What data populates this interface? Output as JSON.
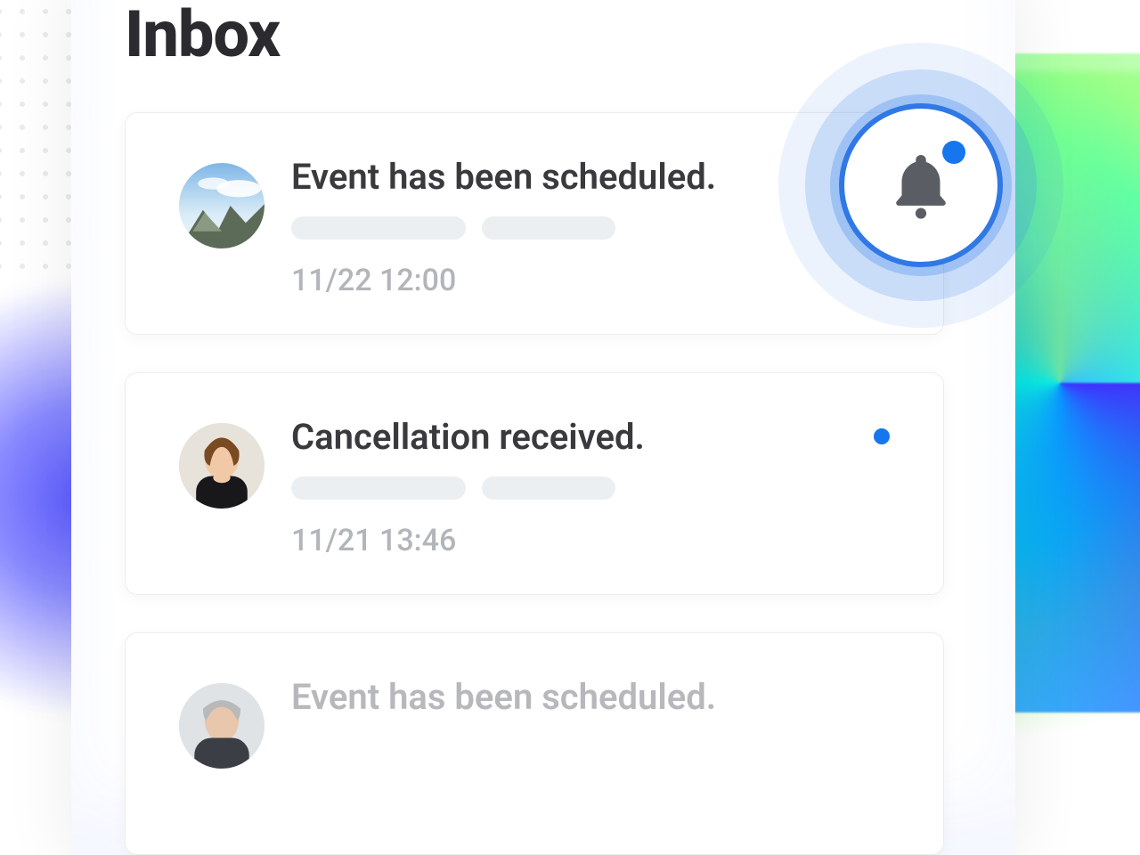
{
  "title": "Inbox",
  "bell": {
    "unread": true
  },
  "cards": [
    {
      "subject": "Event has been scheduled.",
      "timestamp": "11/22 12:00",
      "unread": true,
      "avatar": "mountain"
    },
    {
      "subject": "Cancellation received.",
      "timestamp": "11/21 13:46",
      "unread": true,
      "avatar": "person1"
    },
    {
      "subject": "Event has been scheduled.",
      "timestamp": "",
      "unread": false,
      "avatar": "person2"
    }
  ]
}
